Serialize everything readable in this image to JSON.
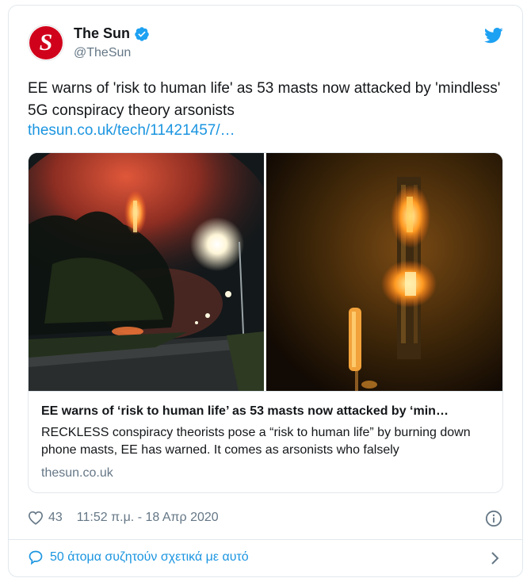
{
  "author": {
    "display_name": "The Sun",
    "handle": "@TheSun",
    "avatar_letter": "S",
    "brand_color": "#d0021b"
  },
  "tweet": {
    "text": "EE warns of 'risk to human life' as 53 masts now attacked by 'mindless' 5G conspiracy theory arsonists",
    "link": "thesun.co.uk/tech/11421457/…"
  },
  "card": {
    "title": "EE warns of ‘risk to human life’ as 53 masts now attacked by ‘min…",
    "description": "RECKLESS conspiracy theorists pose a “risk to human life” by burning down phone masts, EE has warned. It comes as arsonists who falsely",
    "domain": "thesun.co.uk"
  },
  "footer": {
    "likes": "43",
    "timestamp": "11:52 π.μ. - 18 Απρ 2020",
    "conversation": "50 άτομα συζητούν σχετικά με αυτό"
  },
  "colors": {
    "link": "#1b95e0",
    "muted": "#657786",
    "border": "#e1e8ed"
  },
  "icons": [
    "verified-badge-icon",
    "twitter-bird-icon",
    "heart-icon",
    "info-icon",
    "chat-bubble-icon",
    "chevron-right-icon"
  ]
}
